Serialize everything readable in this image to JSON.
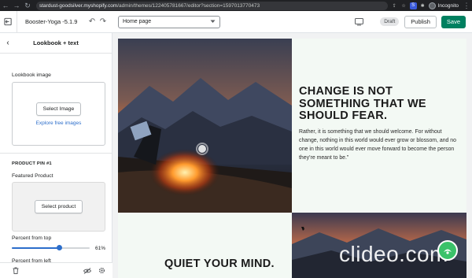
{
  "browser": {
    "url_host": "stardust-goodsilver.myshopify.com",
    "url_path": "/admin/themes/122405781667/editor?section=1597013770473",
    "profile_label": "Incognito"
  },
  "topbar": {
    "theme_name": "Booster-Yoga -5.1.9",
    "page_select_value": "Home page",
    "status_badge": "Draft",
    "publish_label": "Publish",
    "save_label": "Save"
  },
  "sidebar": {
    "title": "Lookbook + text",
    "image_label": "Lookbook image",
    "select_image_label": "Select Image",
    "explore_link": "Explore free images",
    "pin_title": "PRODUCT PIN #1",
    "featured_label": "Featured Product",
    "select_product_label": "Select product",
    "percent_top_label": "Percent from top",
    "percent_top_value": "61%",
    "percent_top_fraction": 0.61,
    "percent_left_label": "Percent from left"
  },
  "preview": {
    "heading": "CHANGE IS NOT SOMETHING THAT WE SHOULD FEAR.",
    "body": "Rather, it is something that we should welcome. For without change, nothing in this world would ever grow or blossom, and no one in this world would ever move forward to become the person they’re meant to be.”",
    "heading2": "QUIET YOUR MIND.",
    "watermark": "clideo.com"
  },
  "colors": {
    "accent": "#008060",
    "link": "#2c6ecb",
    "preview_bg": "#f3f9f4"
  }
}
